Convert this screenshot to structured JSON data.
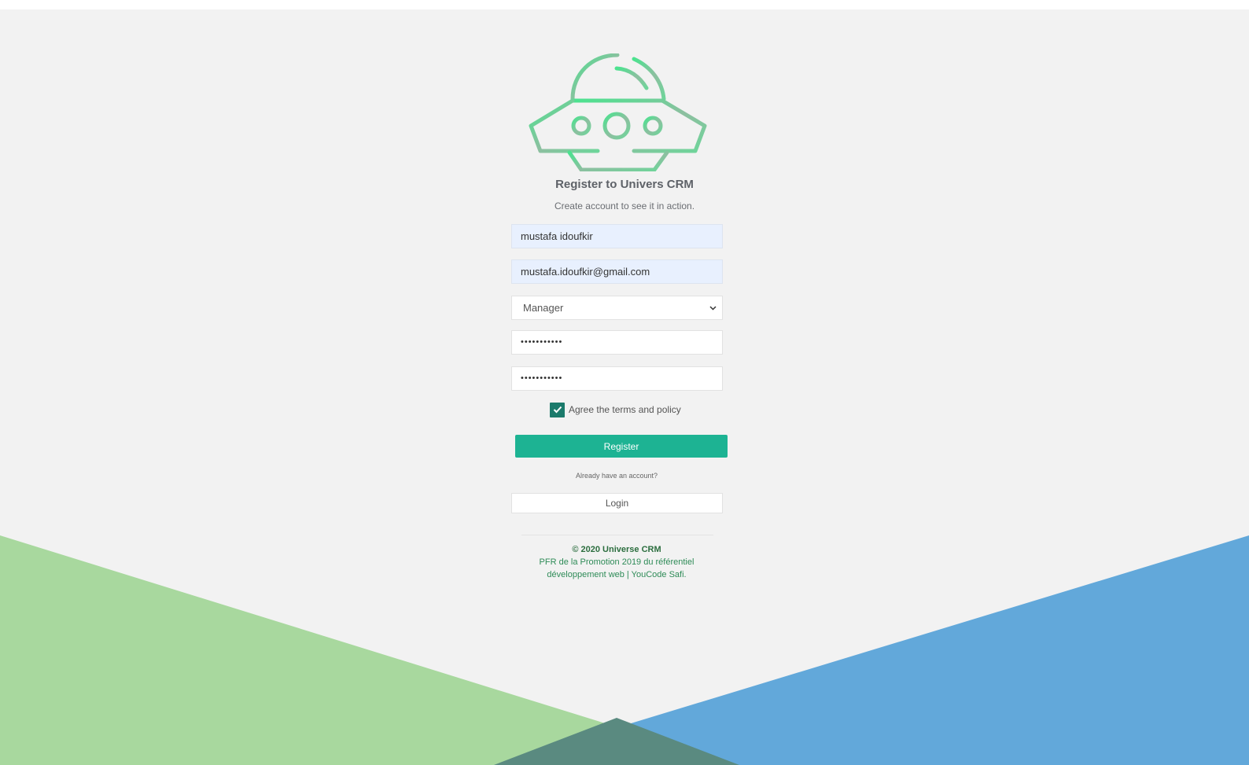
{
  "colors": {
    "page_background": "#f2f2f2",
    "left_shape": "#a8d89e",
    "right_shape": "#62a8da",
    "overlap_shape": "#5a8a80",
    "accent": "#1db393",
    "checkbox": "#1b7a6b",
    "footer_text": "#2e8b57"
  },
  "logo": {
    "icon": "ufo-spaceship-icon"
  },
  "header": {
    "title": "Register to Univers CRM",
    "subtitle": "Create account to see it in action."
  },
  "form": {
    "name_value": "mustafa idoufkir",
    "email_value": "mustafa.idoufkir@gmail.com",
    "role_selected": "Manager",
    "password_mask": "•••••••••••",
    "confirm_password_mask": "•••••••••••",
    "terms_label": "Agree the terms and policy",
    "terms_checked": true,
    "register_label": "Register"
  },
  "login": {
    "prompt": "Already have an account?",
    "button_label": "Login"
  },
  "footer": {
    "copyright": "© 2020 Universe CRM",
    "line1": "PFR de la Promotion 2019 du référentiel",
    "line2": "développement web | YouCode Safi."
  }
}
